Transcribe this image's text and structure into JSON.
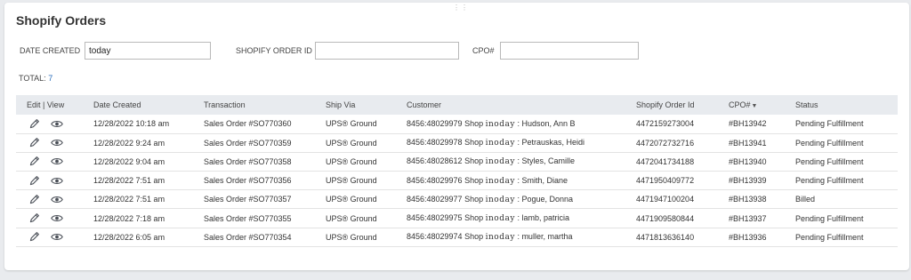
{
  "drag_handle": "⋮⋮",
  "title": "Shopify Orders",
  "filters": {
    "date_created": {
      "label": "DATE CREATED",
      "value": "today"
    },
    "shopify_order_id": {
      "label": "SHOPIFY ORDER ID",
      "value": ""
    },
    "cpo": {
      "label": "CPO#",
      "value": ""
    }
  },
  "total": {
    "label": "TOTAL:",
    "count": "7"
  },
  "columns": {
    "edit_view": "Edit | View",
    "date_created": "Date Created",
    "transaction": "Transaction",
    "ship_via": "Ship Via",
    "customer": "Customer",
    "shopify_order_id": "Shopify Order Id",
    "cpo": "CPO#",
    "cpo_sort_icon": "▼",
    "status": "Status"
  },
  "icons": {
    "edit": "pencil-icon",
    "view": "eye-icon"
  },
  "colors": {
    "accent": "#2a6ebb",
    "header_bg": "#e8ebef",
    "page_bg": "#e9ebee"
  },
  "rows": [
    {
      "date": "12/28/2022 10:18 am",
      "transaction": "Sales Order #SO770360",
      "ship_via": "UPS® Ground",
      "customer_id": "8456:48029979 Shop",
      "customer_shop": "inoday",
      "customer_name": ": Hudson, Ann B",
      "shopify_order_id": "4472159273004",
      "cpo": "#BH13942",
      "status": "Pending Fulfillment"
    },
    {
      "date": "12/28/2022 9:24 am",
      "transaction": "Sales Order #SO770359",
      "ship_via": "UPS® Ground",
      "customer_id": "8456:48029978 Shop",
      "customer_shop": "inoday",
      "customer_name": ": Petrauskas, Heidi",
      "shopify_order_id": "4472072732716",
      "cpo": "#BH13941",
      "status": "Pending Fulfillment"
    },
    {
      "date": "12/28/2022 9:04 am",
      "transaction": "Sales Order #SO770358",
      "ship_via": "UPS® Ground",
      "customer_id": "8456:48028612 Shop",
      "customer_shop": "inoday",
      "customer_name": ": Styles, Camille",
      "shopify_order_id": "4472041734188",
      "cpo": "#BH13940",
      "status": "Pending Fulfillment"
    },
    {
      "date": "12/28/2022 7:51 am",
      "transaction": "Sales Order #SO770356",
      "ship_via": "UPS® Ground",
      "customer_id": "8456:48029976 Shop",
      "customer_shop": "inoday",
      "customer_name": ": Smith, Diane",
      "shopify_order_id": "4471950409772",
      "cpo": "#BH13939",
      "status": "Pending Fulfillment"
    },
    {
      "date": "12/28/2022 7:51 am",
      "transaction": "Sales Order #SO770357",
      "ship_via": "UPS® Ground",
      "customer_id": "8456:48029977 Shop",
      "customer_shop": "inoday",
      "customer_name": ": Pogue, Donna",
      "shopify_order_id": "4471947100204",
      "cpo": "#BH13938",
      "status": "Billed"
    },
    {
      "date": "12/28/2022 7:18 am",
      "transaction": "Sales Order #SO770355",
      "ship_via": "UPS® Ground",
      "customer_id": "8456:48029975 Shop",
      "customer_shop": "inoday",
      "customer_name": ": lamb, patricia",
      "shopify_order_id": "4471909580844",
      "cpo": "#BH13937",
      "status": "Pending Fulfillment"
    },
    {
      "date": "12/28/2022 6:05 am",
      "transaction": "Sales Order #SO770354",
      "ship_via": "UPS® Ground",
      "customer_id": "8456:48029974 Shop",
      "customer_shop": "inoday",
      "customer_name": ": muller, martha",
      "shopify_order_id": "4471813636140",
      "cpo": "#BH13936",
      "status": "Pending Fulfillment"
    }
  ]
}
